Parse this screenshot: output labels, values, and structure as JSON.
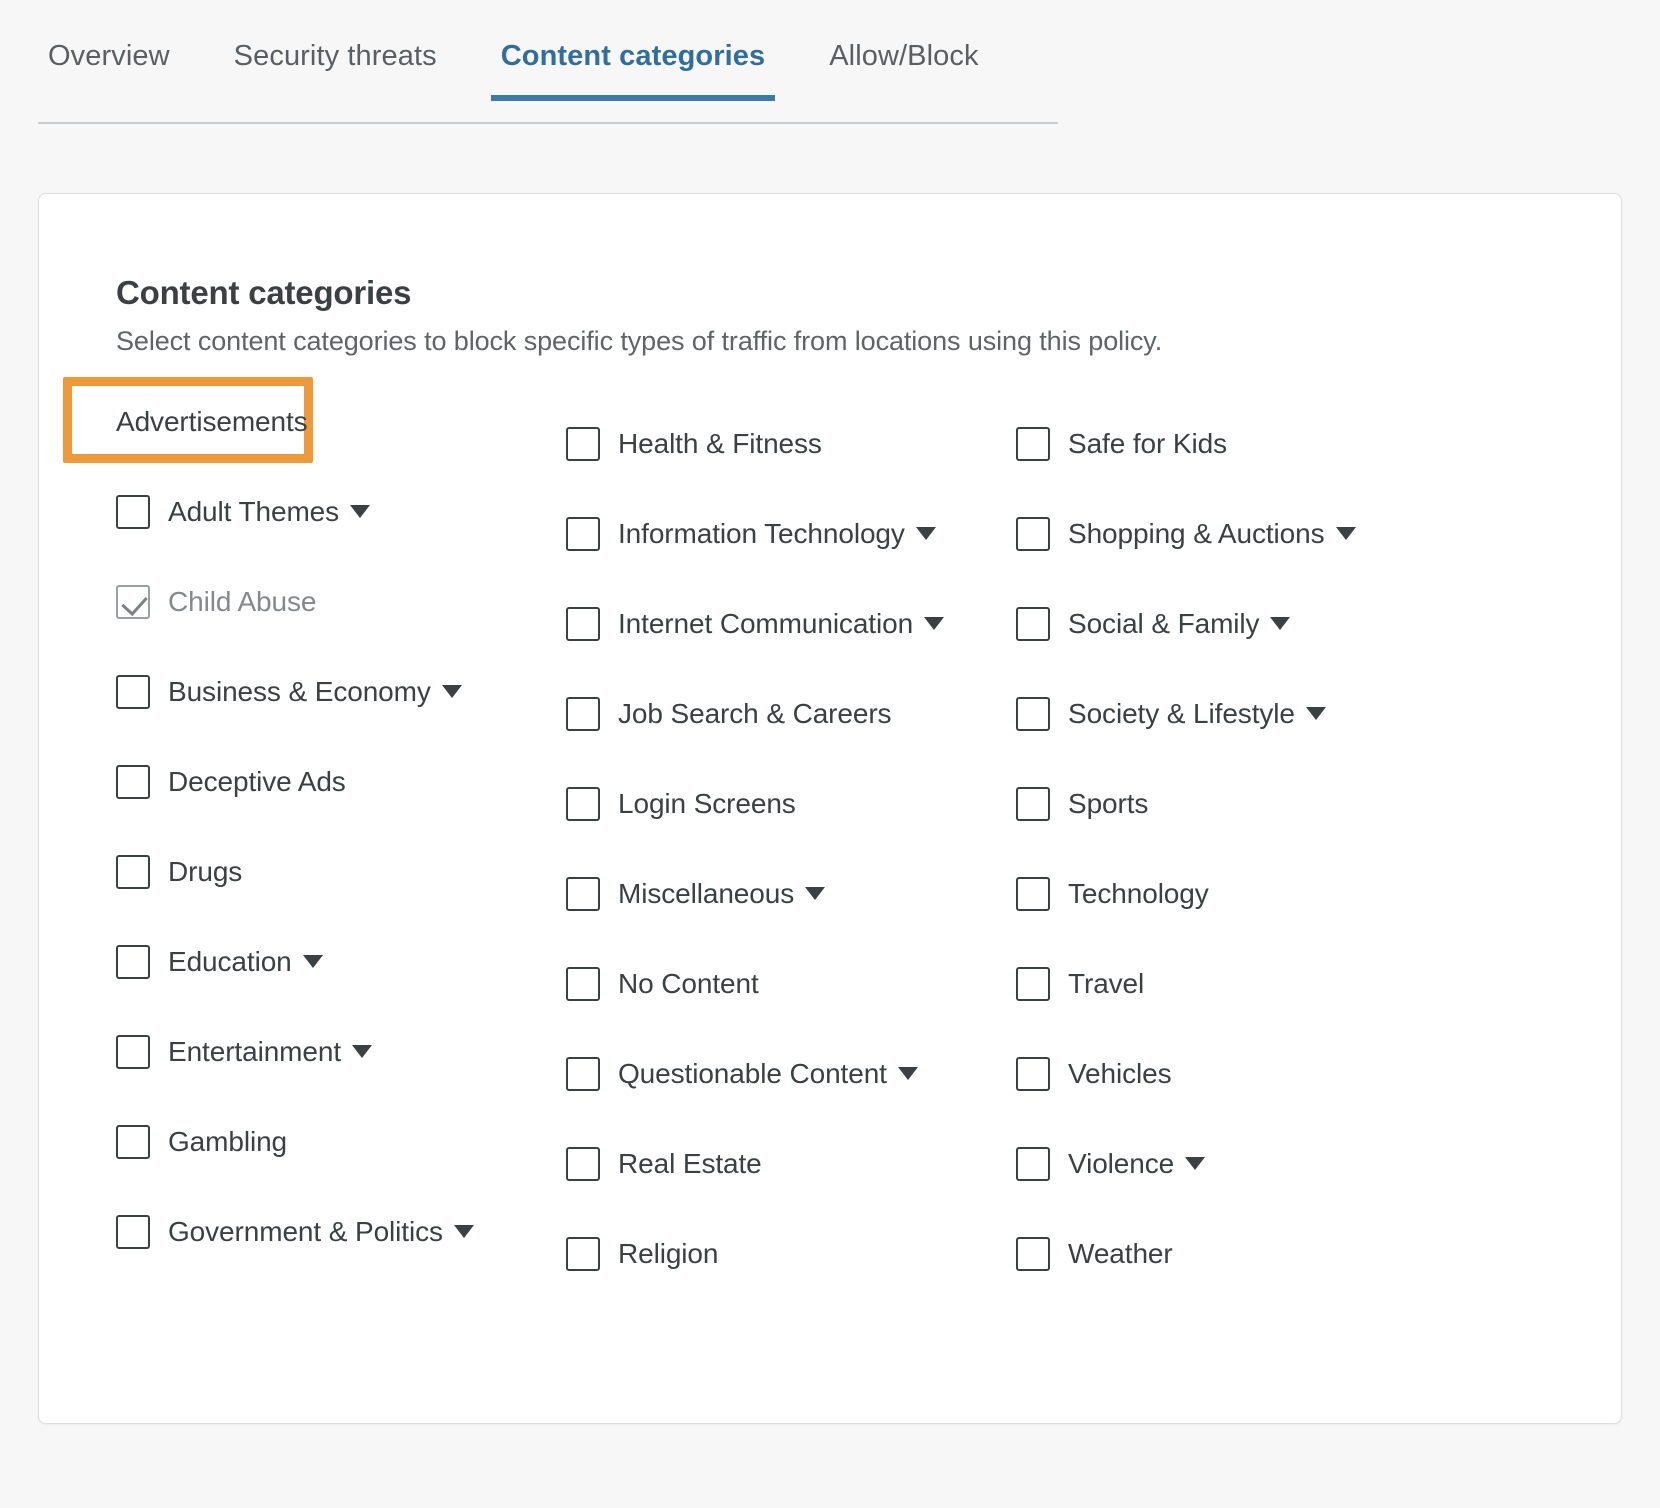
{
  "tabs": [
    {
      "label": "Overview",
      "active": false
    },
    {
      "label": "Security threats",
      "active": false
    },
    {
      "label": "Content categories",
      "active": true
    },
    {
      "label": "Allow/Block",
      "active": false
    }
  ],
  "panel": {
    "title": "Content categories",
    "description": "Select content categories to block specific types of traffic from locations using this policy."
  },
  "highlight": {
    "color": "#ee9a3a",
    "target": "Advertisements"
  },
  "columns": [
    {
      "items": [
        {
          "label": "Advertisements",
          "checked": false,
          "disabled": false,
          "expandable": false,
          "highlighted": true
        },
        {
          "label": "Adult Themes",
          "checked": false,
          "disabled": false,
          "expandable": true,
          "highlighted": false
        },
        {
          "label": "Child Abuse",
          "checked": true,
          "disabled": true,
          "expandable": false,
          "highlighted": false
        },
        {
          "label": "Business & Economy",
          "checked": false,
          "disabled": false,
          "expandable": true,
          "highlighted": false
        },
        {
          "label": "Deceptive Ads",
          "checked": false,
          "disabled": false,
          "expandable": false,
          "highlighted": false
        },
        {
          "label": "Drugs",
          "checked": false,
          "disabled": false,
          "expandable": false,
          "highlighted": false
        },
        {
          "label": "Education",
          "checked": false,
          "disabled": false,
          "expandable": true,
          "highlighted": false
        },
        {
          "label": "Entertainment",
          "checked": false,
          "disabled": false,
          "expandable": true,
          "highlighted": false
        },
        {
          "label": "Gambling",
          "checked": false,
          "disabled": false,
          "expandable": false,
          "highlighted": false
        },
        {
          "label": "Government & Politics",
          "checked": false,
          "disabled": false,
          "expandable": true,
          "highlighted": false
        }
      ]
    },
    {
      "items": [
        {
          "label": "Health & Fitness",
          "checked": false,
          "disabled": false,
          "expandable": false,
          "highlighted": false
        },
        {
          "label": "Information Technology",
          "checked": false,
          "disabled": false,
          "expandable": true,
          "highlighted": false
        },
        {
          "label": "Internet Communication",
          "checked": false,
          "disabled": false,
          "expandable": true,
          "highlighted": false
        },
        {
          "label": "Job Search & Careers",
          "checked": false,
          "disabled": false,
          "expandable": false,
          "highlighted": false
        },
        {
          "label": "Login Screens",
          "checked": false,
          "disabled": false,
          "expandable": false,
          "highlighted": false
        },
        {
          "label": "Miscellaneous",
          "checked": false,
          "disabled": false,
          "expandable": true,
          "highlighted": false
        },
        {
          "label": "No Content",
          "checked": false,
          "disabled": false,
          "expandable": false,
          "highlighted": false
        },
        {
          "label": "Questionable Content",
          "checked": false,
          "disabled": false,
          "expandable": true,
          "highlighted": false
        },
        {
          "label": "Real Estate",
          "checked": false,
          "disabled": false,
          "expandable": false,
          "highlighted": false
        },
        {
          "label": "Religion",
          "checked": false,
          "disabled": false,
          "expandable": false,
          "highlighted": false
        }
      ]
    },
    {
      "items": [
        {
          "label": "Safe for Kids",
          "checked": false,
          "disabled": false,
          "expandable": false,
          "highlighted": false
        },
        {
          "label": "Shopping & Auctions",
          "checked": false,
          "disabled": false,
          "expandable": true,
          "highlighted": false
        },
        {
          "label": "Social & Family",
          "checked": false,
          "disabled": false,
          "expandable": true,
          "highlighted": false
        },
        {
          "label": "Society & Lifestyle",
          "checked": false,
          "disabled": false,
          "expandable": true,
          "highlighted": false
        },
        {
          "label": "Sports",
          "checked": false,
          "disabled": false,
          "expandable": false,
          "highlighted": false
        },
        {
          "label": "Technology",
          "checked": false,
          "disabled": false,
          "expandable": false,
          "highlighted": false
        },
        {
          "label": "Travel",
          "checked": false,
          "disabled": false,
          "expandable": false,
          "highlighted": false
        },
        {
          "label": "Vehicles",
          "checked": false,
          "disabled": false,
          "expandable": false,
          "highlighted": false
        },
        {
          "label": "Violence",
          "checked": false,
          "disabled": false,
          "expandable": true,
          "highlighted": false
        },
        {
          "label": "Weather",
          "checked": false,
          "disabled": false,
          "expandable": false,
          "highlighted": false
        }
      ]
    }
  ]
}
